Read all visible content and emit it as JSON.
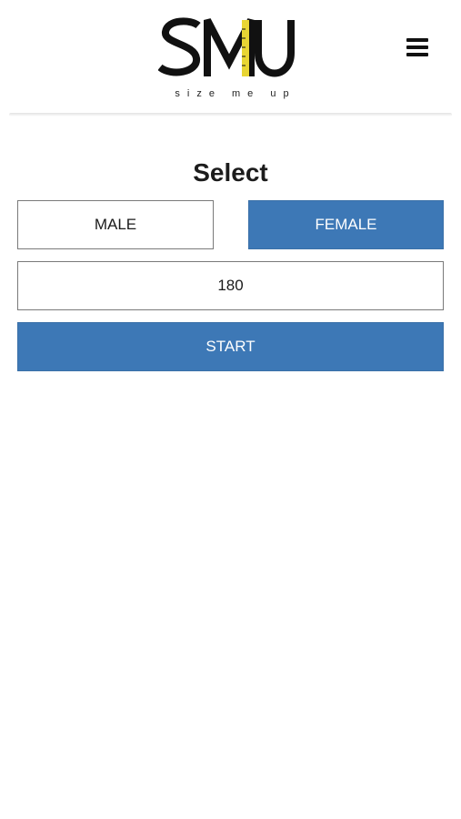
{
  "header": {
    "logo_text": "SMU",
    "tagline": "size me up",
    "menu_icon": "hamburger-menu-icon"
  },
  "main": {
    "title": "Select",
    "gender": {
      "male_label": "MALE",
      "female_label": "FEMALE",
      "selected": "FEMALE"
    },
    "height_value": "180",
    "start_label": "START"
  },
  "colors": {
    "accent": "#3d78b6",
    "logo_highlight": "#e8d534",
    "text": "#1a1a1a"
  }
}
